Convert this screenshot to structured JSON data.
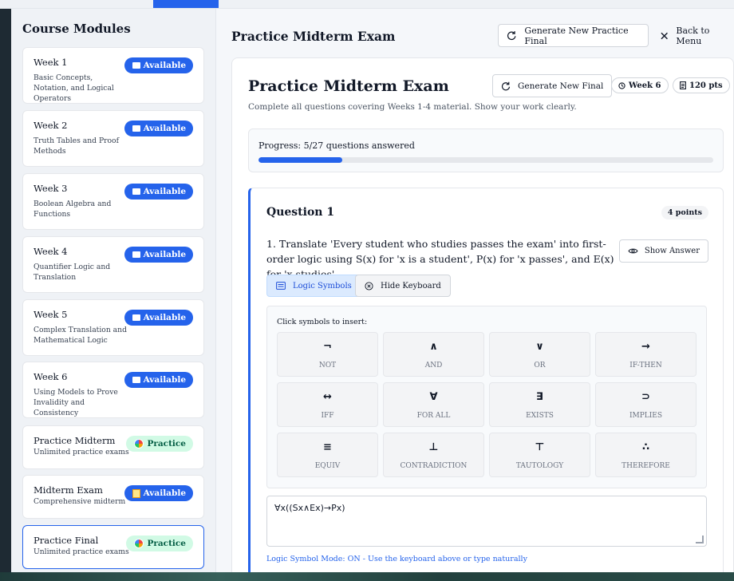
{
  "sidebar": {
    "title": "Course Modules",
    "modules": [
      {
        "title": "Week 1",
        "desc": "Basic Concepts, Notation, and Logical Operators",
        "badge": "Available",
        "badge_type": "available"
      },
      {
        "title": "Week 2",
        "desc": "Truth Tables and Proof Methods",
        "badge": "Available",
        "badge_type": "available"
      },
      {
        "title": "Week 3",
        "desc": "Boolean Algebra and Functions",
        "badge": "Available",
        "badge_type": "available"
      },
      {
        "title": "Week 4",
        "desc": "Quantifier Logic and Translation",
        "badge": "Available",
        "badge_type": "available"
      },
      {
        "title": "Week 5",
        "desc": "Complex Translation and Mathematical Logic",
        "badge": "Available",
        "badge_type": "available"
      },
      {
        "title": "Week 6",
        "desc": "Using Models to Prove Invalidity and Consistency",
        "badge": "Available",
        "badge_type": "available"
      },
      {
        "title": "Practice Midterm",
        "desc": "Unlimited practice exams",
        "badge": "Practice",
        "badge_type": "practice"
      },
      {
        "title": "Midterm Exam",
        "desc": "Comprehensive midterm",
        "badge": "Available",
        "badge_type": "available"
      },
      {
        "title": "Practice Final",
        "desc": "Unlimited practice exams",
        "badge": "Practice",
        "badge_type": "practice"
      }
    ]
  },
  "header": {
    "title": "Practice Midterm Exam",
    "generate_label": "Generate New Practice Final",
    "back_label": "Back to Menu"
  },
  "exam": {
    "title": "Practice Midterm Exam",
    "subtitle": "Complete all questions covering Weeks 1-4 material. Show your work clearly.",
    "generate_label": "Generate New Final",
    "week_label": "Week 6",
    "points_label": "120 pts",
    "progress_label": "Progress: 5/27 questions answered",
    "progress_fraction": 0.185
  },
  "question": {
    "title": "Question 1",
    "points": "4 points",
    "text": "1. Translate 'Every student who studies passes the exam' into first-order logic using S(x) for 'x is a student', P(x) for 'x passes', and E(x) for 'x studies'",
    "show_answer_label": "Show Answer",
    "logic_symbols_label": "Logic Symbols",
    "hide_keyboard_label": "Hide Keyboard",
    "keyboard_label": "Click symbols to insert:",
    "keys": [
      {
        "sym": "¬",
        "name": "NOT"
      },
      {
        "sym": "∧",
        "name": "AND"
      },
      {
        "sym": "∨",
        "name": "OR"
      },
      {
        "sym": "→",
        "name": "IF-THEN"
      },
      {
        "sym": "↔",
        "name": "IFF"
      },
      {
        "sym": "∀",
        "name": "FOR ALL"
      },
      {
        "sym": "∃",
        "name": "EXISTS"
      },
      {
        "sym": "⊃",
        "name": "IMPLIES"
      },
      {
        "sym": "≡",
        "name": "EQUIV"
      },
      {
        "sym": "⊥",
        "name": "CONTRADICTION"
      },
      {
        "sym": "⊤",
        "name": "TAUTOLOGY"
      },
      {
        "sym": "∴",
        "name": "THEREFORE"
      }
    ],
    "answer_value": "∀x((Sx∧Ex)→Px)",
    "mode_text": "Logic Symbol Mode: ON - Use the keyboard above or type naturally"
  },
  "colors": {
    "accent": "#2563eb",
    "practice_badge_bg": "#d1fae5",
    "practice_badge_text": "#065f46"
  }
}
